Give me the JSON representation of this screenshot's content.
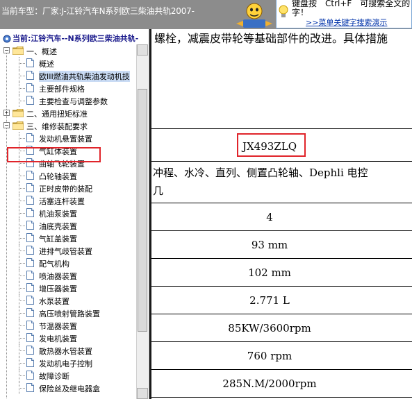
{
  "topbar": {
    "vehicle_label": "当前车型：厂家:J-江铃汽车N系列欧三柴油共轨2007-",
    "tip_line1": "键盘按　Ctrl+F　可搜索全文的",
    "tip_line2": "字！",
    "tip_link": ">>菜单关键字搜索演示"
  },
  "sidebar": {
    "current_path": "当前:江铃汽车--N系列欧三柴油共轨-",
    "tree": [
      {
        "label": "一、概述",
        "type": "folder",
        "expanded": true
      },
      {
        "label": "概述",
        "type": "doc"
      },
      {
        "label": "欧III燃油共轨柴油发动机技",
        "type": "doc",
        "selected": true
      },
      {
        "label": "主要部件规格",
        "type": "doc"
      },
      {
        "label": "主要检查与调整参数",
        "type": "doc"
      },
      {
        "label": "二、通用扭矩标准",
        "type": "folder",
        "expanded": false
      },
      {
        "label": "三、维修装配要求",
        "type": "folder",
        "expanded": true
      },
      {
        "label": "发动机悬置装置",
        "type": "doc"
      },
      {
        "label": "气缸体装置",
        "type": "doc"
      },
      {
        "label": "曲轴飞轮装置",
        "type": "doc"
      },
      {
        "label": "凸轮轴装置",
        "type": "doc"
      },
      {
        "label": "正时皮带的装配",
        "type": "doc"
      },
      {
        "label": "活塞连杆装置",
        "type": "doc"
      },
      {
        "label": "机油泵装置",
        "type": "doc"
      },
      {
        "label": "油底壳装置",
        "type": "doc"
      },
      {
        "label": "气缸盖装置",
        "type": "doc"
      },
      {
        "label": "进排气歧管装置",
        "type": "doc"
      },
      {
        "label": "配气机构",
        "type": "doc"
      },
      {
        "label": "喷油器装置",
        "type": "doc"
      },
      {
        "label": "增压器装置",
        "type": "doc"
      },
      {
        "label": "水泵装置",
        "type": "doc"
      },
      {
        "label": "高压喷射管路装置",
        "type": "doc"
      },
      {
        "label": "节温器装置",
        "type": "doc"
      },
      {
        "label": "发电机装置",
        "type": "doc"
      },
      {
        "label": "散热器水管装置",
        "type": "doc"
      },
      {
        "label": "发动机电子控制",
        "type": "doc"
      },
      {
        "label": "故障诊断",
        "type": "doc"
      },
      {
        "label": "保险丝及继电器盒",
        "type": "doc"
      }
    ]
  },
  "content": {
    "intro_text": "螺栓，减震皮带轮等基础部件的改进。具体措施",
    "model": "JX493ZLQ",
    "desc_line1": "冲程、水冷、直列、侧置凸轮轴、Dephli 电控",
    "desc_line2": "几",
    "rows": [
      "4",
      "93 mm",
      "102 mm",
      "2.771 L",
      "85KW/3600rpm",
      "760 rpm",
      "285N.M/2000rpm"
    ]
  },
  "colors": {
    "topbar_bg": "#8c8c8c",
    "highlight_red": "#e0242a",
    "link_blue": "#0033aa",
    "selected_bg": "#c9dbf4"
  }
}
